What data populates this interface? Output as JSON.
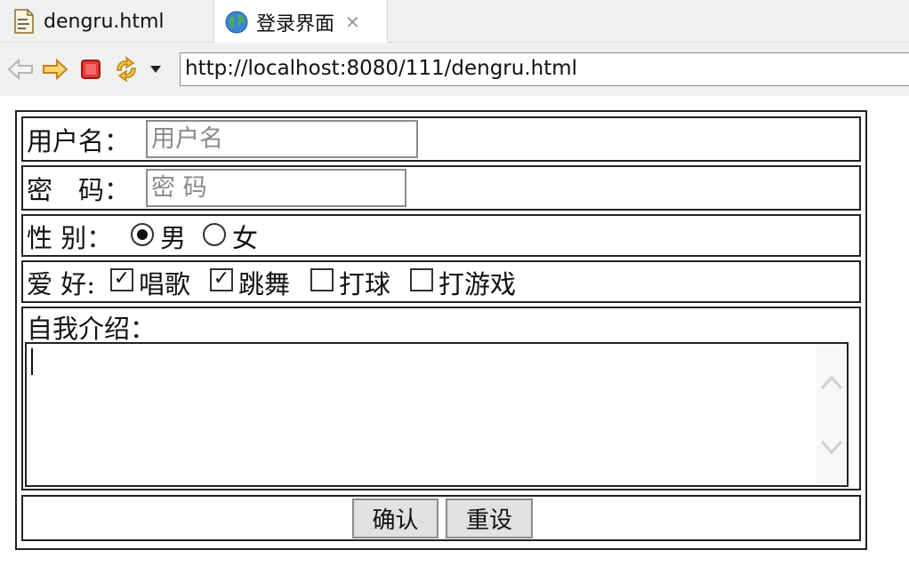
{
  "tabs": [
    {
      "label": "dengru.html",
      "icon": "html-file-icon",
      "active": false
    },
    {
      "label": "登录界面",
      "icon": "globe-icon",
      "active": true
    }
  ],
  "toolbar": {
    "url": "http://localhost:8080/111/dengru.html",
    "buttons": [
      "back-arrow-icon",
      "forward-arrow-icon",
      "stop-icon",
      "refresh-icon",
      "dropdown-icon"
    ]
  },
  "form": {
    "username": {
      "label": "用户名：",
      "placeholder": "用户名",
      "value": ""
    },
    "password": {
      "label": "密　码：",
      "placeholder": "密 码",
      "value": ""
    },
    "gender": {
      "label": "性 别：",
      "options": [
        {
          "label": "男",
          "checked": true
        },
        {
          "label": "女",
          "checked": false
        }
      ]
    },
    "hobbies": {
      "label": "爱 好:",
      "options": [
        {
          "label": "唱歌",
          "checked": true,
          "mark": "✓"
        },
        {
          "label": "跳舞",
          "checked": true,
          "mark": "✓"
        },
        {
          "label": "打球",
          "checked": false,
          "mark": ""
        },
        {
          "label": "打游戏",
          "checked": false,
          "mark": ""
        }
      ]
    },
    "intro": {
      "label": "自我介绍：",
      "value": ""
    },
    "buttons": {
      "submit": "确认",
      "reset": "重设"
    }
  },
  "colors": {
    "border": "#222222",
    "button_bg": "#e1e1e1",
    "chrome_bg": "#f0f0f0"
  }
}
